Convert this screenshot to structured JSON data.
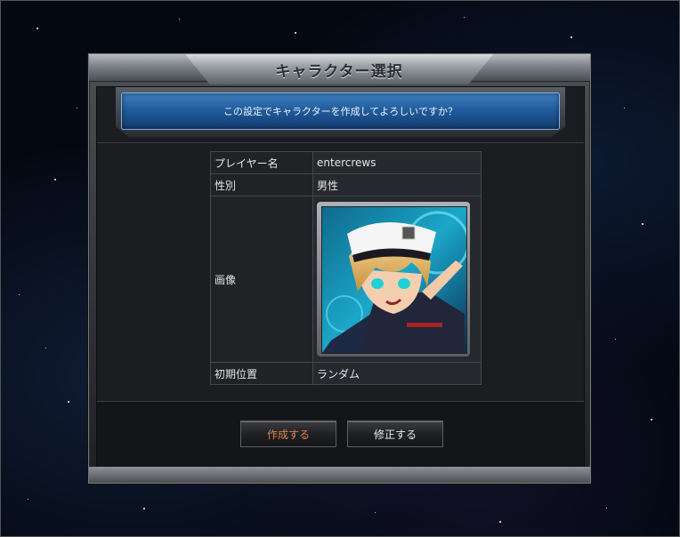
{
  "dialog": {
    "title": "キャラクター選択",
    "message": "この設定でキャラクターを作成してよろしいですか？"
  },
  "table": {
    "rows": [
      {
        "label": "プレイヤー名",
        "value": "entercrews"
      },
      {
        "label": "性別",
        "value": "男性"
      },
      {
        "label": "画像",
        "value": ""
      },
      {
        "label": "初期位置",
        "value": "ランダム"
      }
    ]
  },
  "buttons": {
    "create": "作成する",
    "edit": "修正する"
  },
  "colors": {
    "accent_create": "#e0834a",
    "message_blue": "#1f5a9a"
  }
}
